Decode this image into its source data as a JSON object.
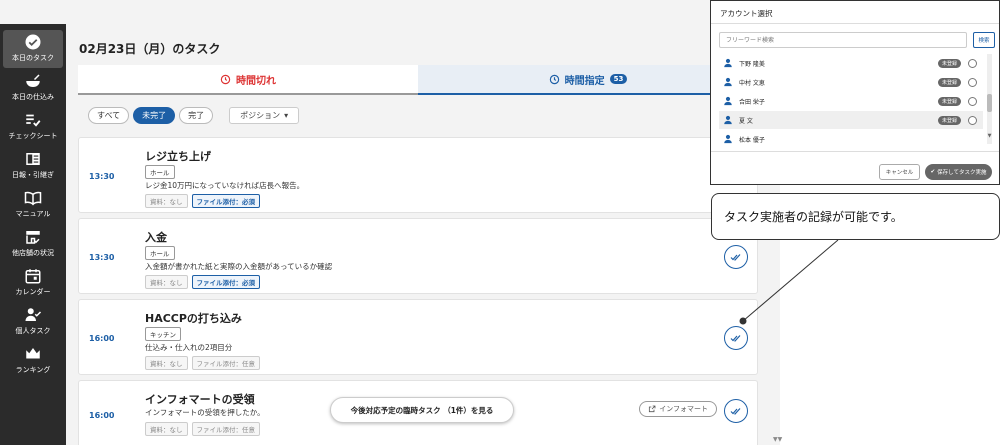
{
  "sidebar": {
    "items": [
      {
        "label": "本日のタスク",
        "icon": "check-circle-icon",
        "active": true
      },
      {
        "label": "本日の仕込み",
        "icon": "bowl-icon"
      },
      {
        "label": "チェックシート",
        "icon": "checklist-icon"
      },
      {
        "label": "日報・引継ぎ",
        "icon": "report-icon"
      },
      {
        "label": "マニュアル",
        "icon": "book-icon"
      },
      {
        "label": "他店舗の状況",
        "icon": "store-icon"
      },
      {
        "label": "カレンダー",
        "icon": "calendar-icon"
      },
      {
        "label": "個人タスク",
        "icon": "person-check-icon"
      },
      {
        "label": "ランキング",
        "icon": "crown-icon"
      }
    ]
  },
  "header": {
    "title": "02月23日（月）のタスク"
  },
  "tabs": {
    "left_label": "時間切れ",
    "right_label": "時間指定",
    "right_count": "53"
  },
  "filters": {
    "all": "すべて",
    "incomplete": "未完了",
    "complete": "完了",
    "position": "ポジション"
  },
  "tasks": [
    {
      "time": "13:30",
      "title": "レジ立ち上げ",
      "tag": "ホール",
      "desc": "レジ金10万円になっていなければ店長へ報告。",
      "meta1": "資料：なし",
      "meta2": "ファイル添付：必須",
      "meta2_required": true
    },
    {
      "time": "13:30",
      "title": "入金",
      "tag": "ホール",
      "desc": "入金額が書かれた紙と実際の入金額があっているか確認",
      "meta1": "資料：なし",
      "meta2": "ファイル添付：必須",
      "meta2_required": true
    },
    {
      "time": "16:00",
      "title": "HACCPの打ち込み",
      "tag": "キッチン",
      "desc": "仕込み・仕入れの2項目分",
      "meta1": "資料：なし",
      "meta2": "ファイル添付：任意",
      "meta2_required": false
    },
    {
      "time": "16:00",
      "title": "インフォマートの受領",
      "tag": "",
      "desc": "インフォマートの受領を押したか。",
      "meta1": "資料：なし",
      "meta2": "ファイル添付：任意",
      "meta2_required": false,
      "ext_label": "インフォマート"
    }
  ],
  "float_button": "今後対応予定の臨時タスク （1件）を見る",
  "modal": {
    "title": "アカウント選択",
    "keyword_placeholder": "フリーワード検索",
    "search_label": "検索",
    "accounts": [
      {
        "name": "下野 隆美",
        "badge": "未登録"
      },
      {
        "name": "中村 文恵",
        "badge": "未登録"
      },
      {
        "name": "合田 栄子",
        "badge": "未登録"
      },
      {
        "name": "夏 文",
        "badge": "未登録",
        "highlighted": true
      },
      {
        "name": "松本 優子",
        "badge": "未登録"
      }
    ],
    "cancel_label": "キャンセル",
    "save_label": "保存してタスク実施"
  },
  "callout": {
    "text": "タスク実施者の記録が可能です。"
  },
  "colors": {
    "accent": "#1d5fa6",
    "danger": "#d33333",
    "sidebar": "#2b2b2b"
  }
}
